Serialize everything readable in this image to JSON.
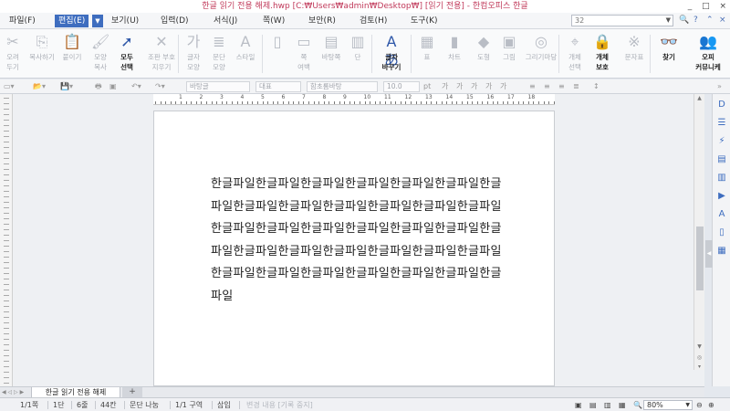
{
  "window": {
    "title": "한글 읽기 전용 해제.hwp [C:₩Users₩admin₩Desktop₩] [읽기 전용] - 한컴오피스 한글",
    "controls": [
      "_",
      "□",
      "×"
    ]
  },
  "menu": {
    "items": [
      {
        "label": "파일(F)"
      },
      {
        "label": "편집(E)",
        "active": true
      },
      {
        "label": "보기(U)"
      },
      {
        "label": "입력(D)"
      },
      {
        "label": "서식(J)"
      },
      {
        "label": "쪽(W)"
      },
      {
        "label": "보안(R)"
      },
      {
        "label": "검토(H)"
      },
      {
        "label": "도구(K)"
      }
    ],
    "search_value": "32"
  },
  "ribbon": {
    "items": [
      {
        "label1": "오려",
        "label2": "두기",
        "icon": "scissors-icon",
        "glyph": "✂"
      },
      {
        "label1": "복사하기",
        "label2": "",
        "icon": "copy-icon",
        "glyph": "⎘"
      },
      {
        "label1": "붙이기",
        "label2": "",
        "icon": "paste-icon",
        "glyph": "📋"
      },
      {
        "label1": "모양",
        "label2": "복사",
        "icon": "format-painter-icon",
        "glyph": "🖌"
      },
      {
        "label1": "모두",
        "label2": "선택",
        "icon": "select-all-icon",
        "glyph": "➚",
        "on": true
      },
      {
        "label1": "조판 부호",
        "label2": "지우기",
        "icon": "clear-codes-icon",
        "glyph": "✕"
      },
      {
        "label1": "글자",
        "label2": "모양",
        "icon": "char-shape-icon",
        "glyph": "가"
      },
      {
        "label1": "문단",
        "label2": "모양",
        "icon": "para-shape-icon",
        "glyph": "≣"
      },
      {
        "label1": "스타일",
        "label2": "",
        "icon": "style-icon",
        "glyph": "A"
      },
      {
        "label1": "",
        "label2": "",
        "icon": "page-icon",
        "glyph": "▯"
      },
      {
        "label1": "쪽",
        "label2": "여백",
        "icon": "margin-icon",
        "glyph": "▭"
      },
      {
        "label1": "바탕쪽",
        "label2": "",
        "icon": "master-page-icon",
        "glyph": "▤"
      },
      {
        "label1": "단",
        "label2": "",
        "icon": "column-icon",
        "glyph": "▥"
      },
      {
        "label1": "글자",
        "label2": "바꾸기",
        "icon": "replace-char-icon",
        "glyph": "Aあ",
        "on": true
      },
      {
        "label1": "표",
        "label2": "",
        "icon": "table-icon",
        "glyph": "▦"
      },
      {
        "label1": "차트",
        "label2": "",
        "icon": "chart-icon",
        "glyph": "▮"
      },
      {
        "label1": "도형",
        "label2": "",
        "icon": "shape-icon",
        "glyph": "◆"
      },
      {
        "label1": "그림",
        "label2": "",
        "icon": "picture-icon",
        "glyph": "▣"
      },
      {
        "label1": "그리기마당",
        "label2": "",
        "icon": "clipart-icon",
        "glyph": "◎"
      },
      {
        "label1": "개체",
        "label2": "선택",
        "icon": "object-select-icon",
        "glyph": "⌖"
      },
      {
        "label1": "개체",
        "label2": "보호",
        "icon": "object-protect-icon",
        "glyph": "🔒",
        "on": true
      },
      {
        "label1": "문자표",
        "label2": "",
        "icon": "symbol-icon",
        "glyph": "※"
      },
      {
        "label1": "찾기",
        "label2": "",
        "icon": "find-icon",
        "glyph": "👓",
        "on": true
      },
      {
        "label1": "오피",
        "label2": "커뮤니케",
        "icon": "community-icon",
        "glyph": "👥",
        "on": true
      }
    ]
  },
  "format_bar": {
    "style_value": "바탕글",
    "lang_value": "대표",
    "font_value": "함초롬바탕",
    "size_value": "10.0",
    "unit": "pt",
    "char_buttons": [
      "가",
      "가",
      "가",
      "가",
      "가"
    ]
  },
  "ruler": {
    "numbers": [
      "1",
      "2",
      "3",
      "4",
      "5",
      "6",
      "7",
      "8",
      "9",
      "10",
      "11",
      "12",
      "13",
      "14",
      "15",
      "16",
      "17",
      "18"
    ]
  },
  "document": {
    "text": "한글파일한글파일한글파일한글파일한글파일한글파일한글파일한글파일한글파일한글파일한글파일한글파일한글파일한글파일한글파일한글파일한글파일한글파일한글파일한글파일한글파일한글파일한글파일한글파일한글파일한글파일한글파일한글파일한글파일한글파일한글파일한글파일한글파일"
  },
  "tabs": {
    "doc_tab": "한글 읽기 전용 해제",
    "add": "+"
  },
  "status": {
    "page": "1/1쪽",
    "col": "1단",
    "line": "6줄",
    "char": "44칸",
    "para_split": "문단 나눔",
    "section": "1/1 구역",
    "mode": "삽입",
    "track": "변경 내용 [기록 중지]",
    "zoom": "80%"
  }
}
